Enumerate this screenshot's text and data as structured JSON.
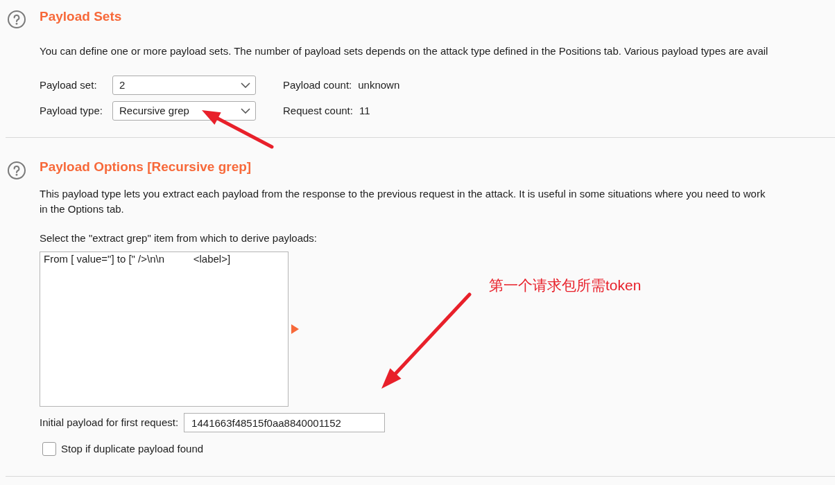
{
  "payload_sets": {
    "title": "Payload Sets",
    "description": "You can define one or more payload sets. The number of payload sets depends on the attack type defined in the Positions tab. Various payload types are avail",
    "fields": [
      {
        "label": "Payload set:",
        "value": "2",
        "count_label": "Payload count:",
        "count_value": "unknown"
      },
      {
        "label": "Payload type:",
        "value": "Recursive grep",
        "count_label": "Request count:",
        "count_value": "11"
      }
    ]
  },
  "payload_options": {
    "title": "Payload Options [Recursive grep]",
    "description_lines": [
      "This payload type lets you extract each payload from the response to the previous request in the attack. It is useful in some situations where you need to work",
      "in the Options tab."
    ],
    "list_label": "Select the \"extract grep\" item from which to derive payloads:",
    "list_items": [
      {
        "text": "From [ value=\"] to [\" />\\n\\n          <label>]",
        "selected": false
      }
    ],
    "initial_payload": {
      "label": "Initial payload for first request:",
      "value": "1441663f48515f0aa8840001152"
    },
    "options": [
      {
        "label": "Stop if duplicate payload found",
        "checked": false
      }
    ]
  },
  "annotation": {
    "text": "第一个请求包所需token"
  }
}
